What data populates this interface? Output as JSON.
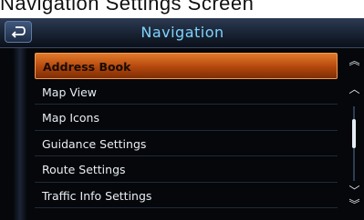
{
  "caption": "Navigation Settings Screen",
  "header": {
    "title": "Navigation"
  },
  "menu": {
    "items": [
      {
        "label": "Address Book",
        "selected": true
      },
      {
        "label": "Map View"
      },
      {
        "label": "Map Icons"
      },
      {
        "label": "Guidance Settings"
      },
      {
        "label": "Route Settings"
      },
      {
        "label": "Traffic Info Settings"
      }
    ]
  },
  "scrollbar": {
    "position": 0.0
  },
  "icons": [
    "back-arrow-icon",
    "page-up-icon",
    "scroll-up-icon",
    "scroll-down-icon",
    "page-down-icon"
  ],
  "colors": {
    "accent": "#c5560f",
    "title": "#7fd4ff",
    "background": "#05070a"
  }
}
